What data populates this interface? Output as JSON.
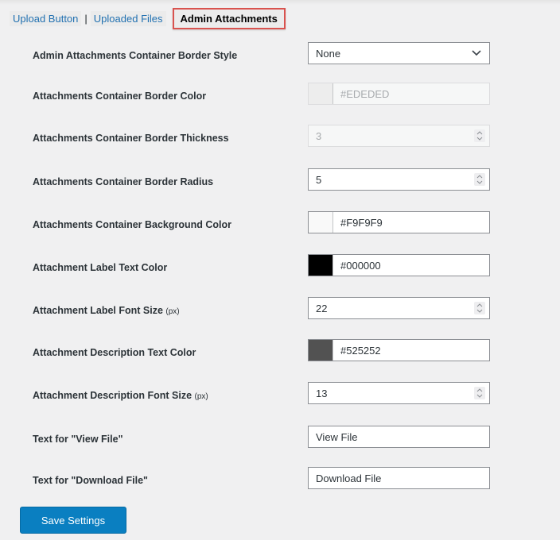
{
  "tabs": {
    "items": [
      {
        "label": "Upload Button",
        "active": false
      },
      {
        "label": "Uploaded Files",
        "active": false
      },
      {
        "label": "Admin Attachments",
        "active": true
      }
    ],
    "separator": "|"
  },
  "settings": [
    {
      "label": "Admin Attachments Container Border Style",
      "type": "select",
      "value": "None"
    },
    {
      "label": "Attachments Container Border Color",
      "type": "color",
      "value": "#EDEDED",
      "swatch": "#ededed",
      "disabled": true
    },
    {
      "label": "Attachments Container Border Thickness",
      "type": "number",
      "value": "3",
      "disabled": true
    },
    {
      "label": "Attachments Container Border Radius",
      "type": "number",
      "value": "5"
    },
    {
      "label": "Attachments Container Background Color",
      "type": "color",
      "value": "#F9F9F9",
      "swatch": "#f9f9f9"
    },
    {
      "label": "Attachment Label Text Color",
      "type": "color",
      "value": "#000000",
      "swatch": "#000000"
    },
    {
      "label": "Attachment Label Font Size",
      "unit": "(px)",
      "type": "number",
      "value": "22"
    },
    {
      "label": "Attachment Description Text Color",
      "type": "color",
      "value": "#525252",
      "swatch": "#525252"
    },
    {
      "label": "Attachment Description Font Size",
      "unit": "(px)",
      "type": "number",
      "value": "13"
    },
    {
      "label": "Text for \"View File\"",
      "type": "text",
      "value": "View File"
    },
    {
      "label": "Text for \"Download File\"",
      "type": "text",
      "value": "Download File"
    }
  ],
  "save_label": "Save Settings",
  "colors": {
    "accent": "#0a7fc1",
    "link": "#2271b1",
    "active_tab_border": "#d9534f"
  }
}
